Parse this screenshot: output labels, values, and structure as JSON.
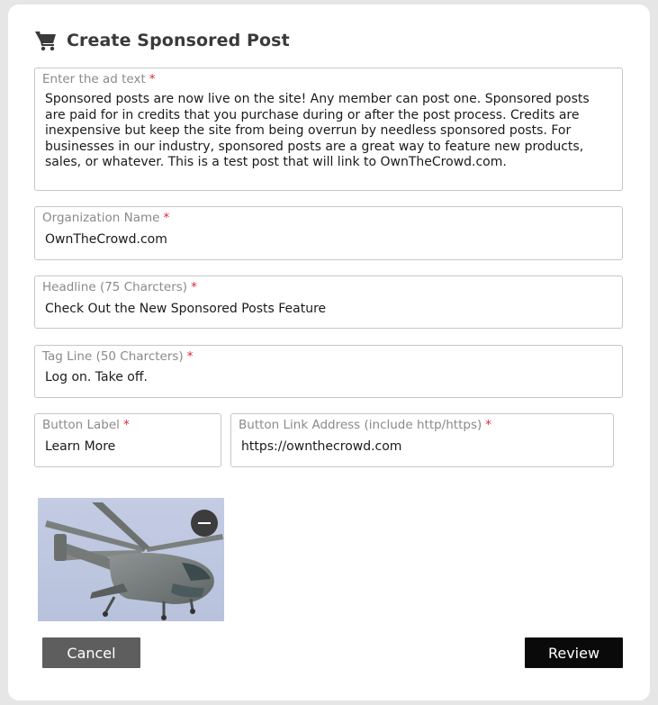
{
  "header": {
    "title": "Create Sponsored Post",
    "icon": "cart-icon"
  },
  "required_marker": "*",
  "fields": {
    "ad_text": {
      "label": "Enter the ad text",
      "value": "Sponsored posts are now live on the site! Any member can post one. Sponsored posts are paid for in credits that you purchase during or after the post process. Credits are inexpensive but keep the site from being overrun by needless sponsored posts. For businesses in our industry, sponsored posts are a great way to feature new products, sales, or whatever. This is a test post that will link to OwnTheCrowd.com."
    },
    "organization": {
      "label": "Organization Name",
      "value": "OwnTheCrowd.com"
    },
    "headline": {
      "label": "Headline (75 Charcters)",
      "value": "Check Out the New Sponsored Posts Feature"
    },
    "tagline": {
      "label": "Tag Line (50 Charcters)",
      "value": "Log on. Take off."
    },
    "button_label": {
      "label": "Button Label",
      "value": "Learn More"
    },
    "button_link": {
      "label": "Button Link Address (include http/https)",
      "value": "https://ownthecrowd.com"
    }
  },
  "image": {
    "subject": "helicopter photo",
    "remove_icon": "minus-circle-icon"
  },
  "actions": {
    "cancel_label": "Cancel",
    "review_label": "Review"
  },
  "colors": {
    "required": "#e0243a",
    "cancel_bg": "#5e5e5e",
    "review_bg": "#0a0a0a"
  }
}
